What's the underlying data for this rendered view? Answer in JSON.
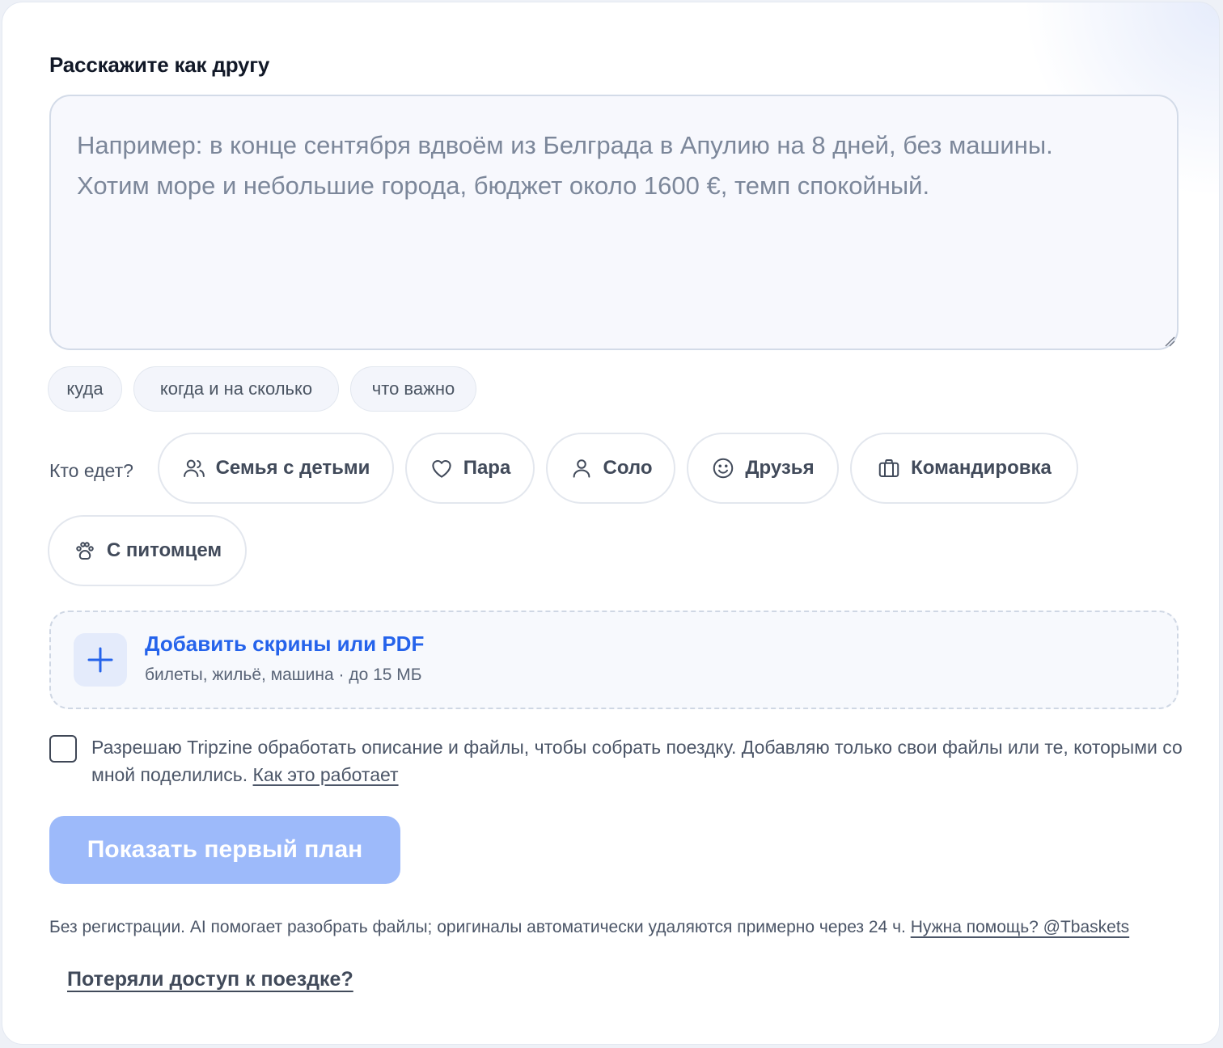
{
  "form": {
    "title": "Расскажите как другу",
    "placeholder": "Например: в конце сентября вдвоём из Белграда в Апулию на 8 дней, без машины.\nХотим море и небольшие города, бюджет около 1600 €, темп спокойный.",
    "hint_chips": [
      "куда",
      "когда и на сколько",
      "что важно"
    ]
  },
  "travelers": {
    "label": "Кто едет?",
    "options": [
      {
        "label": "Семья с детьми",
        "icon": "users-icon"
      },
      {
        "label": "Пара",
        "icon": "heart-icon"
      },
      {
        "label": "Соло",
        "icon": "user-icon"
      },
      {
        "label": "Друзья",
        "icon": "smile-icon"
      },
      {
        "label": "Командировка",
        "icon": "briefcase-icon"
      },
      {
        "label": "С питомцем",
        "icon": "paw-icon"
      }
    ]
  },
  "upload": {
    "title": "Добавить скрины или PDF",
    "subtitle": "билеты, жильё, машина · до 15 МБ"
  },
  "consent": {
    "text": "Разрешаю Tripzine обработать описание и файлы, чтобы собрать поездку. Добавляю только свои файлы или те, которыми со мной поделились.",
    "link": "Как это работает",
    "checked": false
  },
  "cta": {
    "label": "Показать первый план",
    "enabled": false
  },
  "footer": {
    "text": "Без регистрации. AI помогает разобрать файлы; оригиналы автоматически удаляются примерно через 24 ч.",
    "help_link": "Нужна помощь? @Tbaskets",
    "lost_access_link": "Потеряли доступ к поездке?"
  },
  "colors": {
    "accent": "#2563eb",
    "cta_disabled": "#9dbafa",
    "field_bg": "#f7f8fd",
    "border": "#d3dbe8"
  }
}
